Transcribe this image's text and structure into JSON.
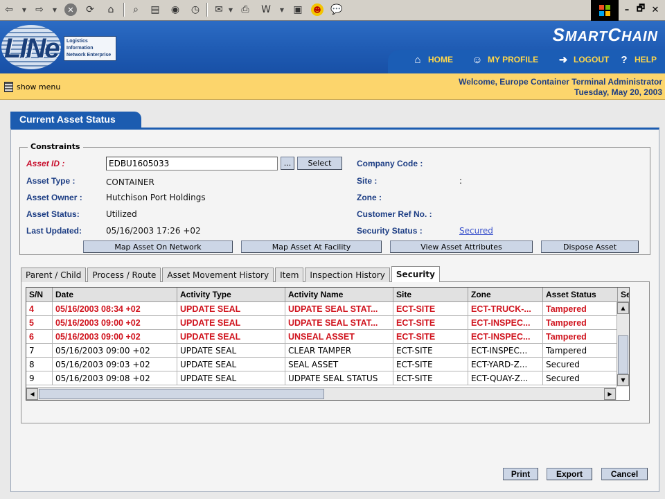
{
  "window": {
    "controls": [
      "–",
      "🗗",
      "✕"
    ]
  },
  "header": {
    "logo_text": "LINe",
    "logo_tagline_1": "Logistics Information",
    "logo_tagline_2": "Network Enterprise",
    "brand_S": "S",
    "brand_MART": "MART",
    "brand_C": "C",
    "brand_HAIN": "HAIN",
    "nav": [
      {
        "label": "HOME",
        "icon": "home-icon"
      },
      {
        "label": "MY PROFILE",
        "icon": "profile-icon"
      },
      {
        "label": "LOGOUT",
        "icon": "logout-icon"
      },
      {
        "label": "HELP",
        "icon": "help-icon"
      }
    ]
  },
  "welcome_bar": {
    "show_menu": "show menu",
    "welcome": "Welcome, Europe Container Terminal Administrator",
    "date": "Tuesday, May 20, 2003"
  },
  "page": {
    "title": "Current Asset Status",
    "constraints_legend": "Constraints"
  },
  "constraints": {
    "asset_id_label": "Asset ID :",
    "asset_id_value": "EDBU1605033",
    "ellipsis_label": "...",
    "select_label": "Select",
    "asset_type_label": "Asset Type :",
    "asset_type_value": "CONTAINER",
    "asset_owner_label": "Asset Owner :",
    "asset_owner_value": "Hutchison Port Holdings",
    "asset_status_label": "Asset Status:",
    "asset_status_value": "Utilized",
    "last_updated_label": "Last Updated:",
    "last_updated_value": "05/16/2003 17:26 +02",
    "company_code_label": "Company Code :",
    "site_label": "Site :",
    "site_value": ":",
    "zone_label": "Zone :",
    "customer_ref_label": "Customer Ref No. :",
    "security_status_label": "Security Status :",
    "security_status_value": "Secured"
  },
  "actions": {
    "map_network": "Map Asset On Network",
    "map_facility": "Map Asset At Facility",
    "view_attributes": "View Asset Attributes",
    "dispose": "Dispose Asset"
  },
  "tabs": [
    {
      "label": "Parent / Child",
      "active": false
    },
    {
      "label": "Process / Route",
      "active": false
    },
    {
      "label": "Asset Movement History",
      "active": false
    },
    {
      "label": "Item",
      "active": false
    },
    {
      "label": "Inspection History",
      "active": false
    },
    {
      "label": "Security",
      "active": true
    }
  ],
  "grid": {
    "columns": [
      "S/N",
      "Date",
      "Activity Type",
      "Activity Name",
      "Site",
      "Zone",
      "Asset Status",
      "Se"
    ],
    "rows": [
      {
        "alert": true,
        "cells": [
          "4",
          "05/16/2003 08:34 +02",
          "UPDATE SEAL",
          "UDPATE SEAL STAT...",
          "ECT-SITE",
          "ECT-TRUCK-...",
          "Tampered"
        ]
      },
      {
        "alert": true,
        "cells": [
          "5",
          "05/16/2003 09:00 +02",
          "UPDATE SEAL",
          "UDPATE SEAL STAT...",
          "ECT-SITE",
          "ECT-INSPEC...",
          "Tampered"
        ]
      },
      {
        "alert": true,
        "cells": [
          "6",
          "05/16/2003 09:00 +02",
          "UPDATE SEAL",
          "UNSEAL ASSET",
          "ECT-SITE",
          "ECT-INSPEC...",
          "Tampered"
        ]
      },
      {
        "alert": false,
        "cells": [
          "7",
          "05/16/2003 09:00 +02",
          "UPDATE SEAL",
          "CLEAR TAMPER",
          "ECT-SITE",
          "ECT-INSPEC...",
          "Tampered"
        ]
      },
      {
        "alert": false,
        "cells": [
          "8",
          "05/16/2003 09:03 +02",
          "UPDATE SEAL",
          "SEAL ASSET",
          "ECT-SITE",
          "ECT-YARD-Z...",
          "Secured"
        ]
      },
      {
        "alert": false,
        "cells": [
          "9",
          "05/16/2003 09:08 +02",
          "UPDATE SEAL",
          "UDPATE SEAL STATUS",
          "ECT-SITE",
          "ECT-QUAY-Z...",
          "Secured"
        ]
      }
    ],
    "alert_color": "#d0141e"
  },
  "footer": {
    "print": "Print",
    "export": "Export",
    "cancel": "Cancel"
  },
  "colors": {
    "header_blue": "#1f5bb3",
    "nav_yellow": "#ffd84a",
    "welcome_bg": "#fcd56c",
    "label_blue": "#1c3d84",
    "required_red": "#c8102e"
  }
}
